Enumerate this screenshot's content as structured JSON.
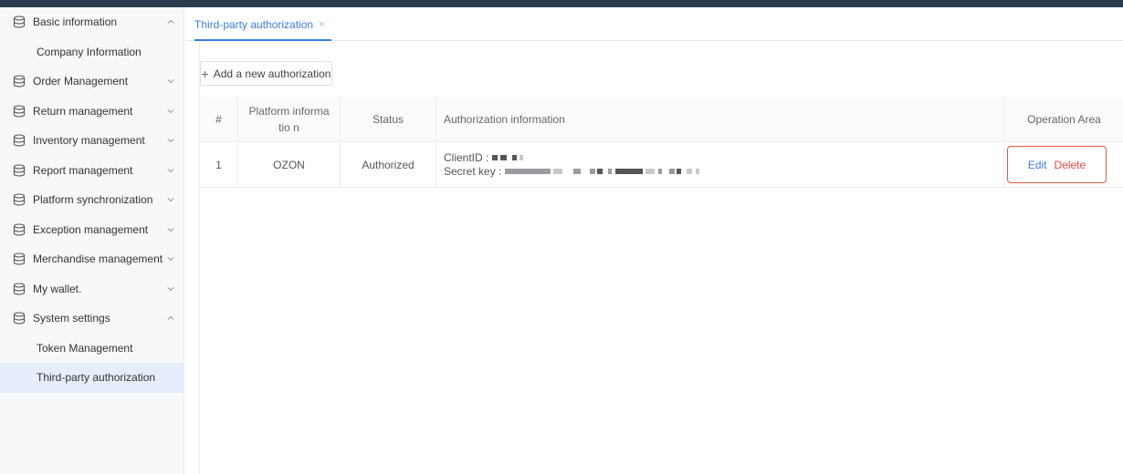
{
  "sidebar": {
    "basic_information": "Basic information",
    "company_information": "Company Information",
    "order_management": "Order Management",
    "return_management": "Return management",
    "inventory_management": "Inventory management",
    "report_management": "Report management",
    "platform_synchronization": "Platform synchronization",
    "exception_management": "Exception management",
    "merchandise_management": "Merchandise management",
    "my_wallet": "My wallet.",
    "system_settings": "System settings",
    "token_management": "Token Management",
    "third_party_authorization": "Third-party authorization"
  },
  "tabs": {
    "active_label": "Third-party authorization",
    "close_glyph": "×"
  },
  "toolbar": {
    "add_label": "Add a new authorization",
    "add_icon": "+"
  },
  "table": {
    "headers": {
      "index": "#",
      "platform": "Platform informatio n",
      "status": "Status",
      "authorization": "Authorization information",
      "operation": "Operation Area"
    },
    "rows": [
      {
        "index": "1",
        "platform": "OZON",
        "status": "Authorized",
        "client_id_label": "ClientID :",
        "secret_key_label": "Secret key :",
        "edit_label": "Edit",
        "delete_label": "Delete"
      }
    ]
  },
  "colors": {
    "accent": "#3a7ee6",
    "danger": "#e8483b",
    "highlight_box": "#e25b45",
    "topbar": "#2b3a4e"
  },
  "icons": {
    "menu": "database-icon",
    "expand": "chevron-down-icon",
    "collapse": "chevron-up-icon"
  }
}
